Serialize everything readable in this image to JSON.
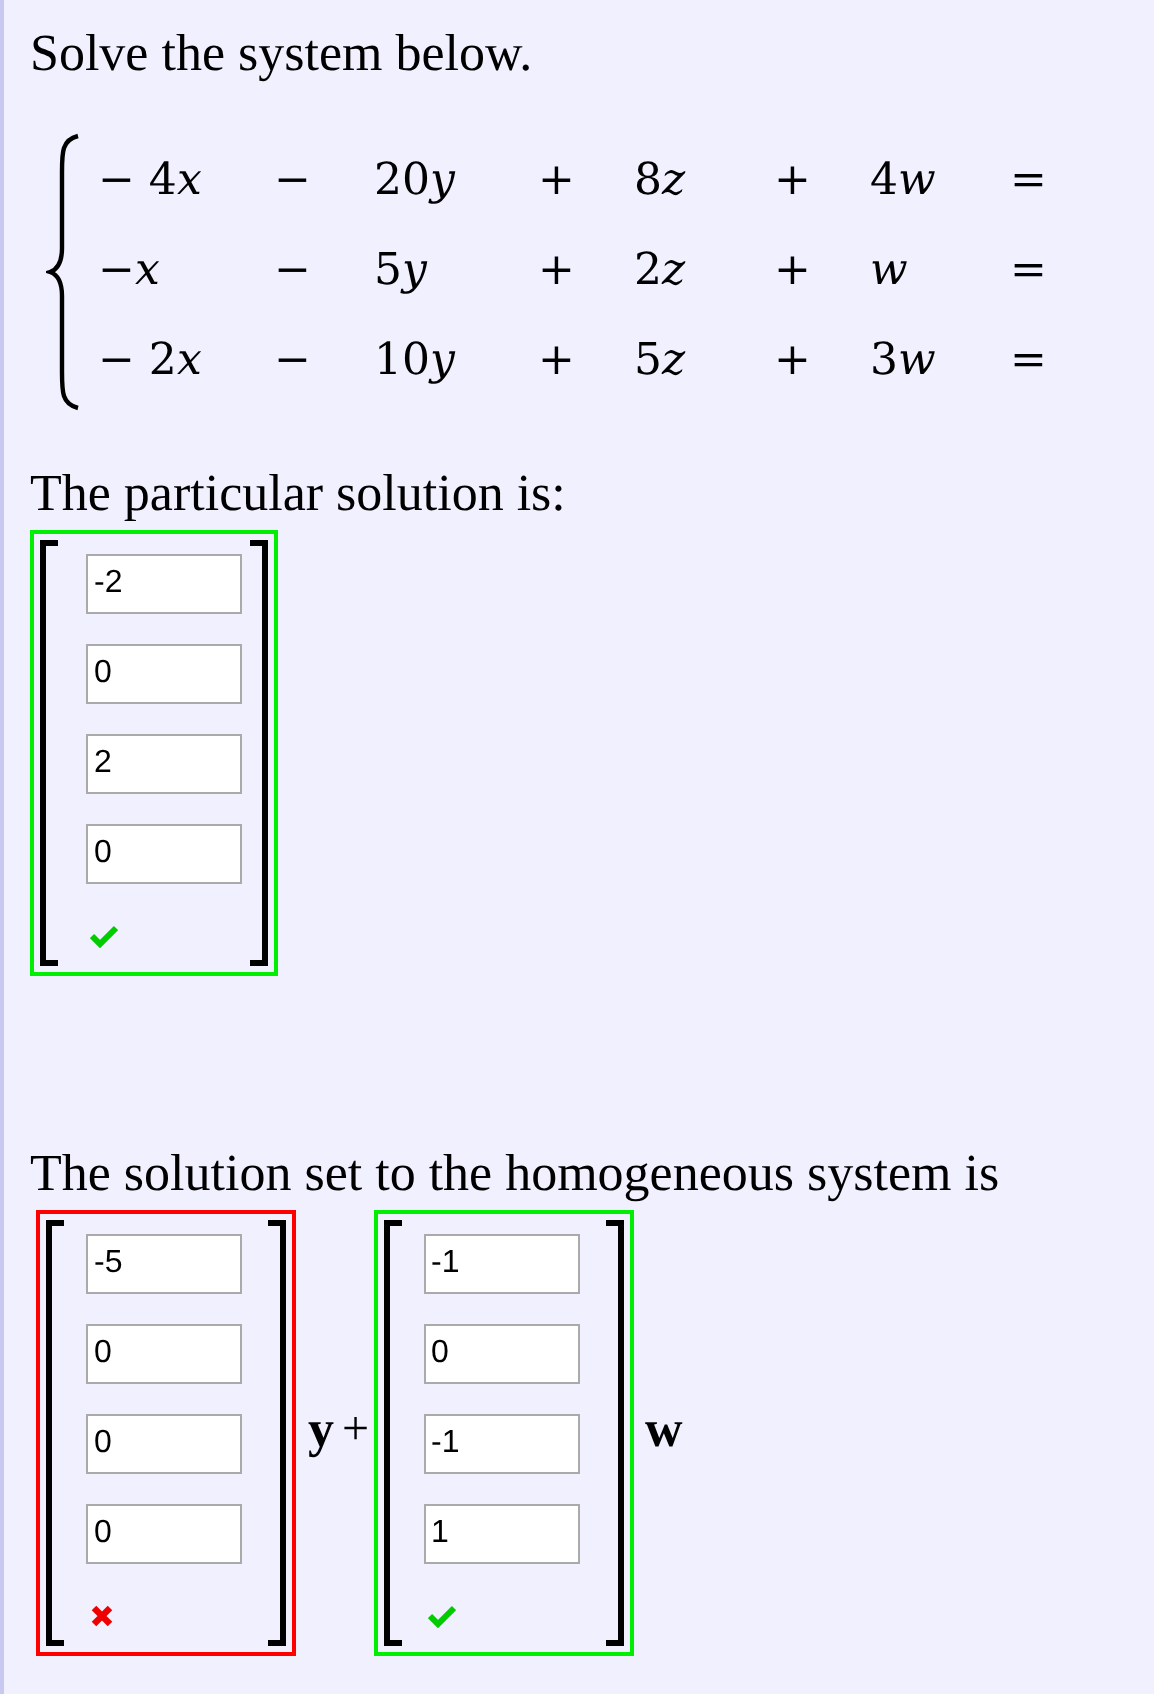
{
  "prompt": "Solve the system below.",
  "system": [
    [
      {
        "coefficient": "− 4",
        "variable": "x"
      },
      "−",
      {
        "coefficient": "20",
        "variable": "y"
      },
      "+",
      {
        "coefficient": "8",
        "variable": "z"
      },
      "+",
      {
        "coefficient": "4",
        "variable": "w"
      },
      "="
    ],
    [
      {
        "coefficient": "−",
        "variable": "x"
      },
      "−",
      {
        "coefficient": "5",
        "variable": "y"
      },
      "+",
      {
        "coefficient": "2",
        "variable": "z"
      },
      "+",
      {
        "variable": "w"
      },
      "="
    ],
    [
      {
        "coefficient": "− 2",
        "variable": "x"
      },
      "−",
      {
        "coefficient": "10",
        "variable": "y"
      },
      "+",
      {
        "coefficient": "5",
        "variable": "z"
      },
      "+",
      {
        "coefficient": "3",
        "variable": "w"
      },
      "="
    ]
  ],
  "particular": {
    "label": "The particular solution is:",
    "correct": true,
    "values": [
      "-2",
      "0",
      "2",
      "0"
    ]
  },
  "homogeneous": {
    "label": "The solution set to the homogeneous system is",
    "vectors": [
      {
        "correct": false,
        "values": [
          "-5",
          "0",
          "0",
          "0"
        ],
        "variable": "y",
        "operator": "+"
      },
      {
        "correct": true,
        "values": [
          "-1",
          "0",
          "-1",
          "1"
        ],
        "variable": "w"
      }
    ]
  }
}
